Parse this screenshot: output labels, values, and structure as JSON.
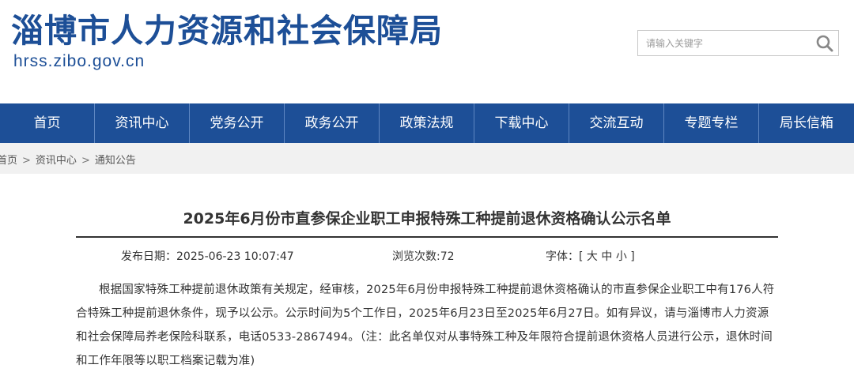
{
  "header": {
    "site_title": "淄博市人力资源和社会保障局",
    "site_domain": "hrss.zibo.gov.cn",
    "brand_color": "#1d4f97"
  },
  "search": {
    "placeholder": "请输入关键字",
    "icon": "search-icon"
  },
  "nav": {
    "items": [
      {
        "label": "首页"
      },
      {
        "label": "资讯中心"
      },
      {
        "label": "党务公开"
      },
      {
        "label": "政务公开"
      },
      {
        "label": "政策法规"
      },
      {
        "label": "下载中心"
      },
      {
        "label": "交流互动"
      },
      {
        "label": "专题专栏"
      },
      {
        "label": "局长信箱"
      }
    ]
  },
  "breadcrumb": {
    "items": [
      "首页",
      "资讯中心",
      "通知公告"
    ],
    "separator": ">"
  },
  "article": {
    "title": "2025年6月份市直参保企业职工申报特殊工种提前退休资格确认公示名单",
    "publish_label": "发布日期：2025-06-23 10:07:47",
    "views_label": "浏览次数:72",
    "font_label": "字体：[",
    "font_large": "大",
    "font_medium": "中",
    "font_small": "小",
    "font_close": "]",
    "body": "根据国家特殊工种提前退休政策有关规定，经审核，2025年6月份申报特殊工种提前退休资格确认的市直参保企业职工中有176人符合特殊工种提前退休条件，现予以公示。公示时间为5个工作日，2025年6月23日至2025年6月27日。如有异议，请与淄博市人力资源和社会保障局养老保险科联系，电话0533-2867494。（注：此名单仅对从事特殊工种及年限符合提前退休资格人员进行公示，退休时间和工作年限等以职工档案记载为准)"
  }
}
